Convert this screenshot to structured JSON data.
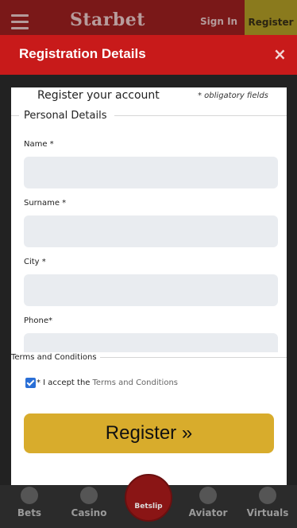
{
  "header": {
    "logo": "Starbet",
    "sign_in": "Sign In",
    "register": "Register"
  },
  "modal": {
    "title": "Registration Details",
    "close": "×",
    "panel_title": "Register your account",
    "obligatory": "* obligatory fields",
    "personal_details": "Personal Details",
    "fields": [
      {
        "label": "Name *",
        "value": ""
      },
      {
        "label": "Surname *",
        "value": ""
      },
      {
        "label": "City *",
        "value": ""
      },
      {
        "label": "Phone*",
        "value": ""
      }
    ],
    "terms_section": "Terms and Conditions",
    "accept_text": "* I accept the",
    "terms_link": "Terms and Conditions",
    "register_button": "Register »"
  },
  "bottom_nav": {
    "items": [
      {
        "label": "Bets",
        "icon": "bets-icon"
      },
      {
        "label": "Casino",
        "icon": "casino-chip-icon"
      },
      {
        "label": "Betslip",
        "icon": "betslip-icon"
      },
      {
        "label": "Aviator",
        "icon": "airplane-icon"
      },
      {
        "label": "Virtuals",
        "icon": "virtuals-icon"
      }
    ]
  },
  "colors": {
    "header_red": "#c81a1a",
    "register_gold": "#d8ac2c",
    "input_bg": "#e9ecf0"
  }
}
